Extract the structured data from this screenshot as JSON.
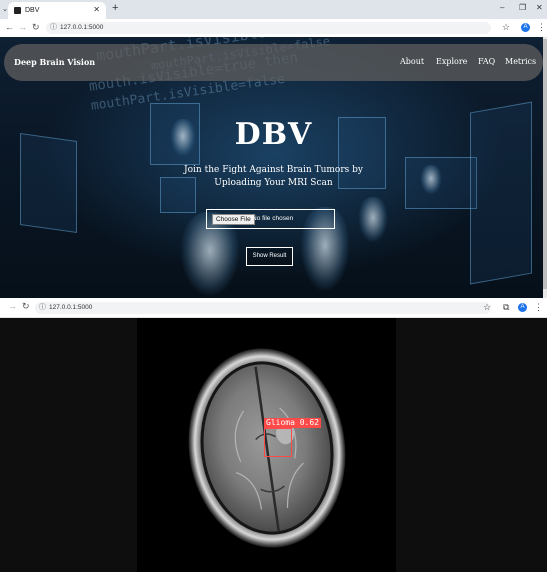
{
  "browser_top": {
    "tab_title": "DBV",
    "url": "127.0.0.1:5000",
    "profile_initial": "A"
  },
  "site": {
    "brand": "Deep Brain Vision",
    "nav": [
      "About",
      "Explore",
      "FAQ",
      "Metrics"
    ],
    "hero_title": "DBV",
    "hero_subtitle": "Join the Fight Against Brain Tumors by Uploading Your MRI Scan",
    "file_button": "Choose File",
    "file_status": "No file chosen",
    "submit_label": "Show Result"
  },
  "background_code_lines": [
    "mouthPart.isVisible=false",
    "mouthPart.isVisible=false",
    "mouth.isVisible=true then",
    "mouthPart.isVisible=false"
  ],
  "browser_bottom": {
    "url": "127.0.0.1:5000",
    "profile_initial": "A"
  },
  "result": {
    "detection_label": "Glioma 0.62",
    "detection_class": "Glioma",
    "confidence": 0.62,
    "box_color": "#ff4a4a"
  }
}
